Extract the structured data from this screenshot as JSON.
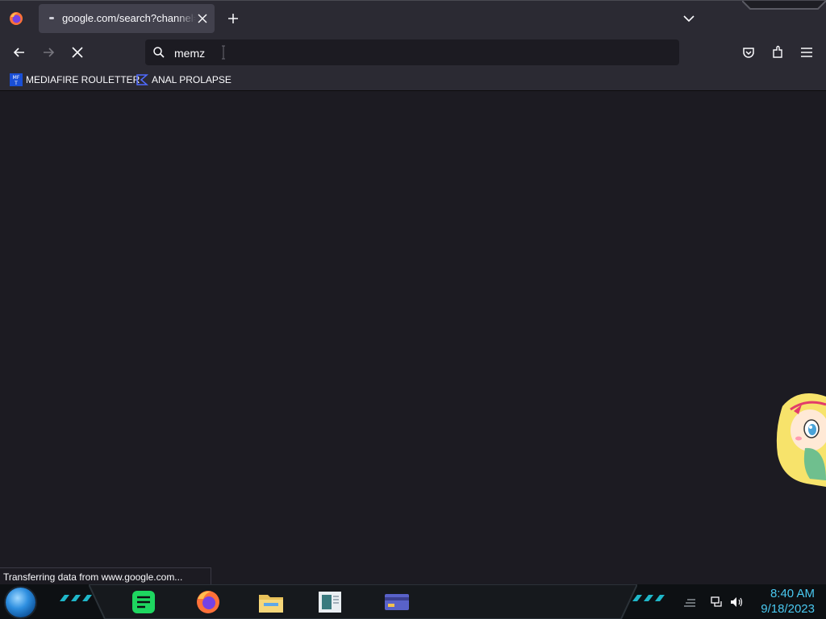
{
  "tab": {
    "title": "google.com/search?channel=fs"
  },
  "urlbar": {
    "value": "memz"
  },
  "bookmarks": [
    {
      "label": "MEDIAFIRE ROULETTER",
      "icon": "mediafire-icon",
      "icon_text": "MF T"
    },
    {
      "label": "ANAL PROLAPSE",
      "icon": "sigma-icon"
    }
  ],
  "status": {
    "text": "Transferring data from www.google.com..."
  },
  "taskbar": {
    "apps": [
      "spotify-icon",
      "firefox-icon",
      "file-explorer-icon",
      "document-icon",
      "card-icon"
    ],
    "time": "8:40 AM",
    "date": "9/18/2023"
  },
  "colors": {
    "accent": "#49c8f0",
    "toolbar": "#2b2a33",
    "content": "#1c1b22"
  }
}
